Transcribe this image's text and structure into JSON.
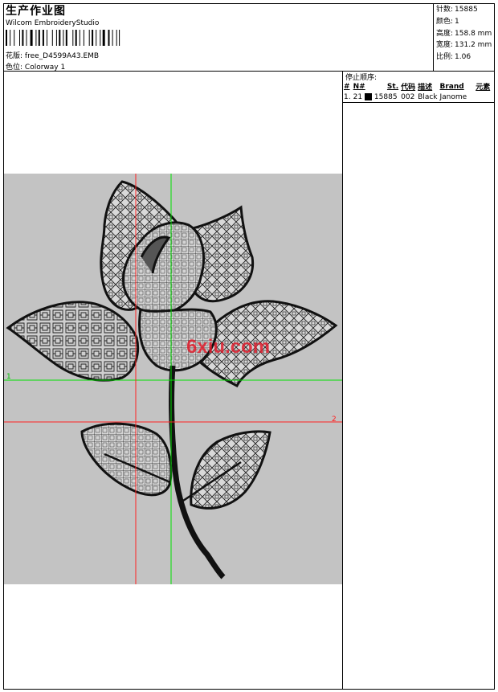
{
  "header": {
    "title": "生产作业图",
    "software": "Wilcom EmbroideryStudio",
    "design_label": "花版:",
    "design_value": "free_D4599A43.EMB",
    "colorway_label": "色位:",
    "colorway_value": "Colorway 1"
  },
  "stats": [
    {
      "label": "针数:",
      "value": "15885"
    },
    {
      "label": "颜色:",
      "value": "1"
    },
    {
      "label": "高度:",
      "value": "158.8 mm"
    },
    {
      "label": "宽度:",
      "value": "131.2 mm"
    },
    {
      "label": "比例:",
      "value": "1.06"
    }
  ],
  "stop_sequence": {
    "heading": "停止顺序:",
    "columns": [
      "#",
      "N#",
      "St.",
      "代码",
      "描述",
      "Brand",
      "元素"
    ],
    "rows": [
      {
        "index": "1.",
        "needle": "21",
        "swatch_color": "#000000",
        "stitches": "15885",
        "code": "002",
        "description": "Black",
        "brand": "Janome",
        "element": ""
      }
    ]
  },
  "canvas": {
    "background": "#c3c3c3",
    "guide_green_label": "1",
    "guide_red_label": "2",
    "watermark": "6xiu.com",
    "watermark_color": "#e01c2c"
  }
}
